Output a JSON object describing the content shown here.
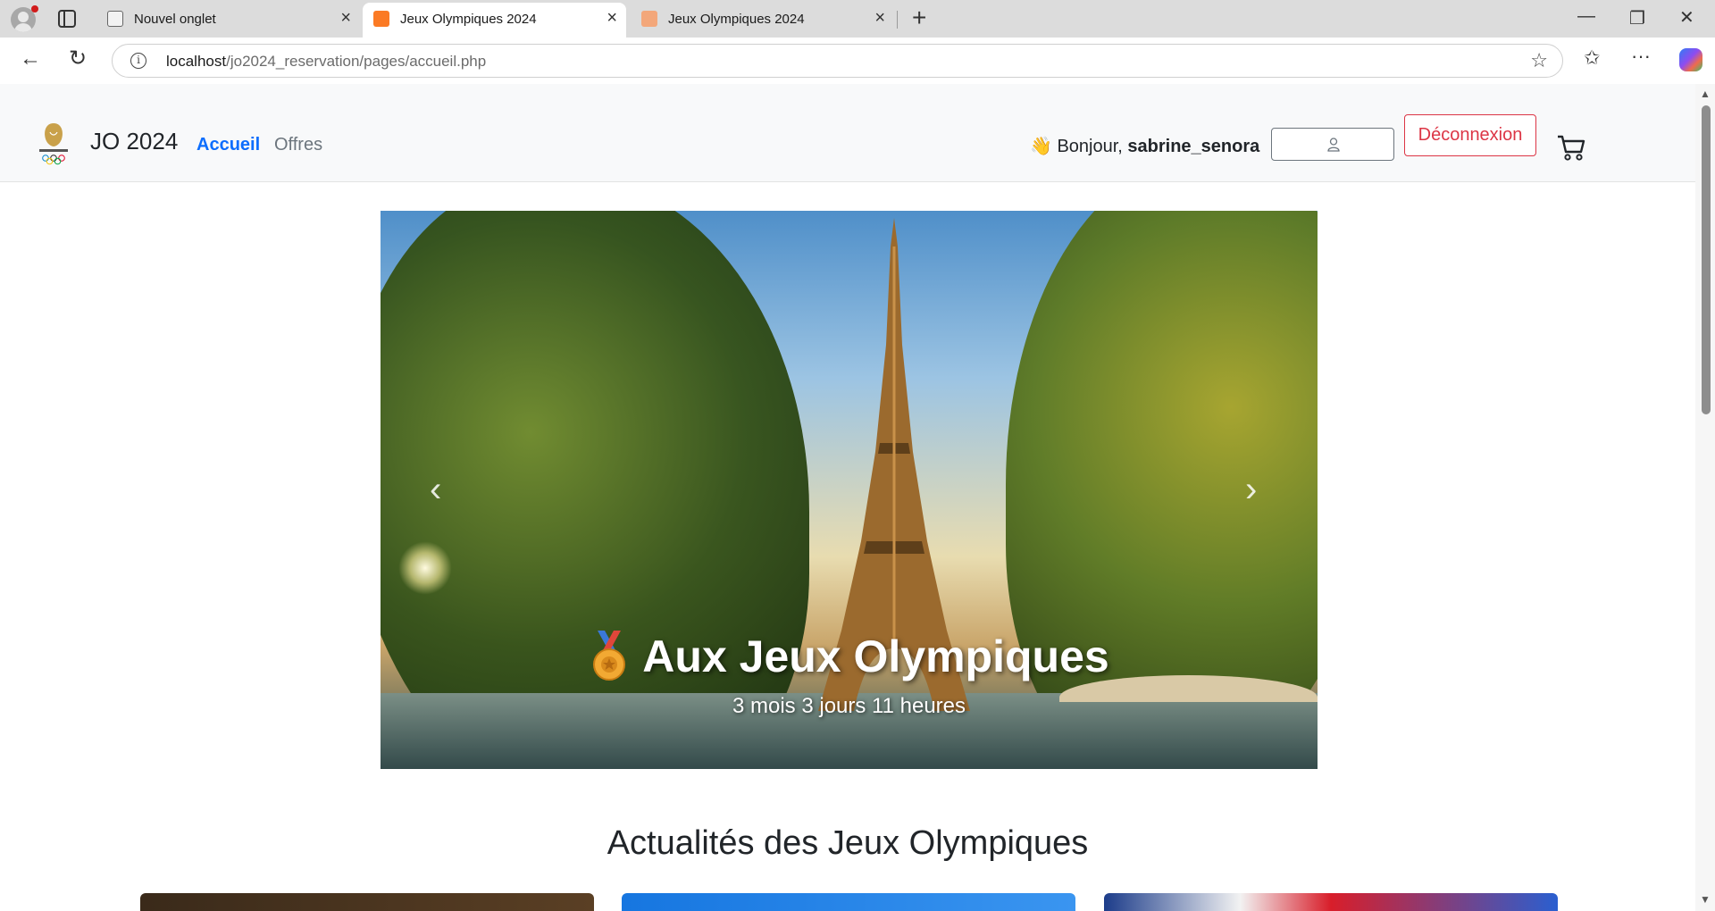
{
  "browser": {
    "tabs": [
      {
        "title": "Nouvel onglet",
        "active": false
      },
      {
        "title": "Jeux Olympiques 2024",
        "active": true
      },
      {
        "title": "Jeux Olympiques 2024",
        "active": false
      }
    ],
    "url_host": "localhost",
    "url_path": "/jo2024_reservation/pages/accueil.php"
  },
  "navbar": {
    "brand": "JO 2024",
    "links": {
      "home": "Accueil",
      "offers": "Offres"
    },
    "greeting_prefix": "👋 Bonjour, ",
    "username": "sabrine_senora",
    "logout": "Déconnexion"
  },
  "carousel": {
    "title": "Aux Jeux Olympiques",
    "countdown": "3 mois 3 jours 11 heures"
  },
  "news": {
    "heading": "Actualités des Jeux Olympiques"
  },
  "colors": {
    "primary": "#0d6efd",
    "danger": "#dc3545",
    "muted": "#6c757d"
  }
}
